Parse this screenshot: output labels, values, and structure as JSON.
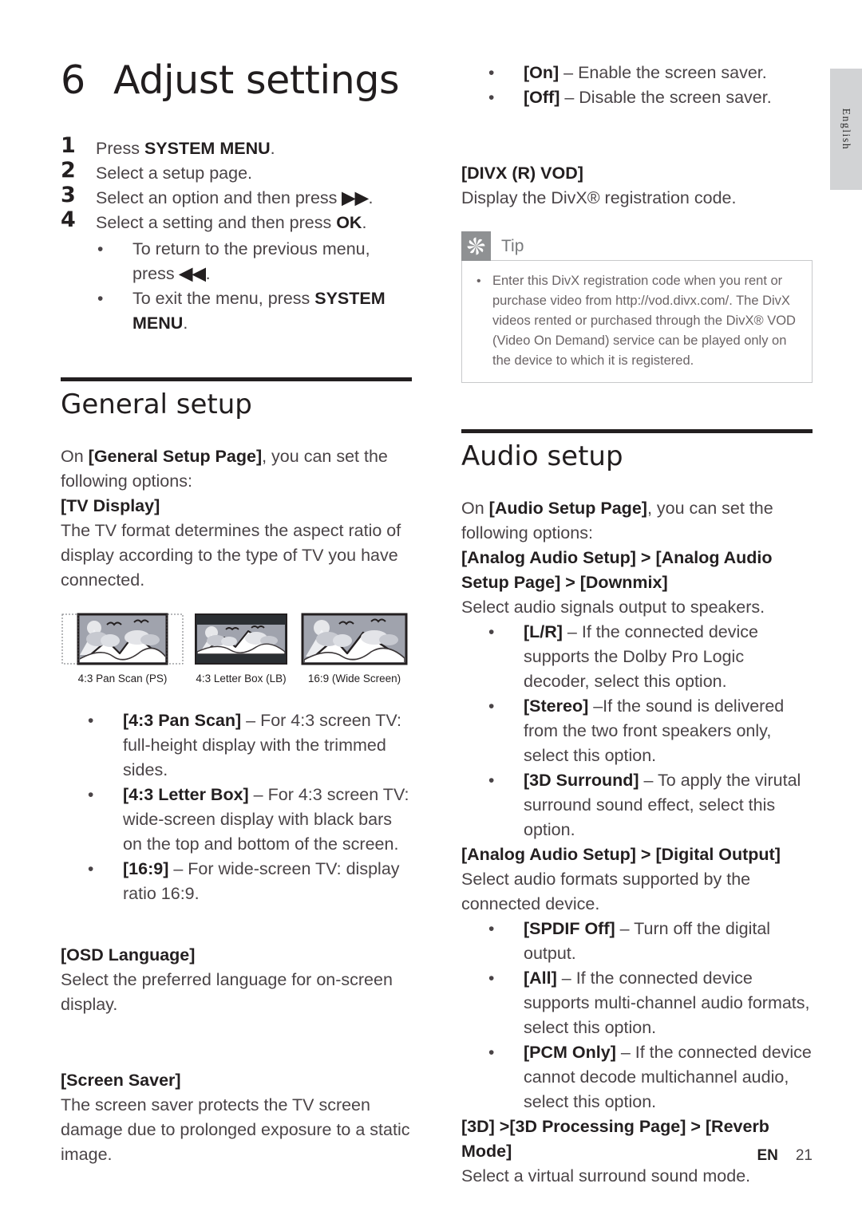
{
  "page": {
    "language_tab": "English",
    "footer_en": "EN",
    "footer_page": "21"
  },
  "chapter": {
    "number": "6",
    "title": "Adjust settings"
  },
  "steps": [
    {
      "num": "1",
      "text_pre": "Press ",
      "text_bold": "SYSTEM MENU",
      "text_post": "."
    },
    {
      "num": "2",
      "text_pre": "Select a setup page.",
      "text_bold": "",
      "text_post": ""
    },
    {
      "num": "3",
      "text_pre": "Select an option and then press ",
      "text_bold": "▶▶",
      "text_post": "."
    },
    {
      "num": "4",
      "text_pre": "Select a setting and then press ",
      "text_bold": "OK",
      "text_post": "."
    }
  ],
  "step_substeps": [
    {
      "pre": "To return to the previous menu, press ",
      "bold": "◀◀",
      "post": "."
    },
    {
      "pre": "To exit the menu, press ",
      "bold": "SYSTEM MENU",
      "post": "."
    }
  ],
  "general_setup": {
    "title": "General setup",
    "intro_pre": "On ",
    "intro_bold": "[General Setup Page]",
    "intro_post": ", you can set the following options:",
    "tv_display_head": "[TV Display]",
    "tv_display_body": "The TV format determines the aspect ratio of display according to the type of TV you have connected.",
    "figures": [
      {
        "name": "4:3 Pan Scan (PS)",
        "type": "pan-scan"
      },
      {
        "name": "4:3 Letter Box (LB)",
        "type": "letter-box"
      },
      {
        "name": "16:9 (Wide Screen)",
        "type": "wide-screen"
      }
    ],
    "tv_options": [
      {
        "bold": "[4:3 Pan Scan]",
        "rest": " – For 4:3 screen TV: full-height display with the trimmed sides."
      },
      {
        "bold": "[4:3 Letter Box]",
        "rest": " – For 4:3 screen TV: wide-screen display with black bars on the top and bottom of the screen."
      },
      {
        "bold": "[16:9]",
        "rest": " – For wide-screen TV: display ratio 16:9."
      }
    ],
    "osd_head": "[OSD Language]",
    "osd_body": "Select the preferred language for on-screen display.",
    "screensaver_head": "[Screen Saver]",
    "screensaver_body": "The screen saver protects the TV screen damage due to prolonged exposure to a static image."
  },
  "screensaver_options": [
    {
      "bold": "[On]",
      "rest": " – Enable the screen saver."
    },
    {
      "bold": "[Off]",
      "rest": " – Disable the screen saver."
    }
  ],
  "divx": {
    "head": "[DIVX (R) VOD]",
    "body": "Display the DivX® registration code."
  },
  "tip": {
    "label": "Tip",
    "icon": "asterisk-flower-icon",
    "items": [
      "Enter this DivX registration code when you rent or purchase video from http://vod.divx.com/. The DivX videos rented or purchased through the DivX® VOD (Video On Demand) service can be played only on the device to which it is registered."
    ]
  },
  "audio_setup": {
    "title": "Audio setup",
    "intro_pre": "On ",
    "intro_bold": "[Audio Setup Page]",
    "intro_post": ", you can set the following options:",
    "downmix_head": "[Analog Audio Setup] > [Analog Audio Setup Page] > [Downmix]",
    "downmix_body": "Select audio signals output to speakers.",
    "downmix_options": [
      {
        "bold": "[L/R]",
        "rest": " – If the connected device supports the Dolby Pro Logic decoder, select this option."
      },
      {
        "bold": "[Stereo]",
        "rest": " –If the sound is delivered from the two front speakers only, select this option."
      },
      {
        "bold": "[3D Surround]",
        "rest": " – To apply the virutal surround sound effect, select this option."
      }
    ],
    "digital_head": "[Analog Audio Setup] > [Digital Output]",
    "digital_body": "Select audio formats supported by the connected device.",
    "digital_options": [
      {
        "bold": "[SPDIF Off]",
        "rest": " – Turn off the digital output."
      },
      {
        "bold": "[All]",
        "rest": " – If the connected device supports multi-channel audio formats, select this option."
      },
      {
        "bold": "[PCM Only]",
        "rest": " – If the connected device cannot decode multichannel audio, select this option."
      }
    ],
    "reverb_head": "[3D] >[3D Processing Page] > [Reverb Mode]",
    "reverb_body": "Select a virtual surround sound mode."
  },
  "colors": {
    "text": "#4a4447",
    "heading": "#211d1e",
    "tab_bg": "#d2d3d5",
    "tip_icon_bg": "#8f9193",
    "tip_border": "#c8c9cb",
    "figure_sky": "#a0a3ad",
    "figure_frame": "#231f20"
  }
}
